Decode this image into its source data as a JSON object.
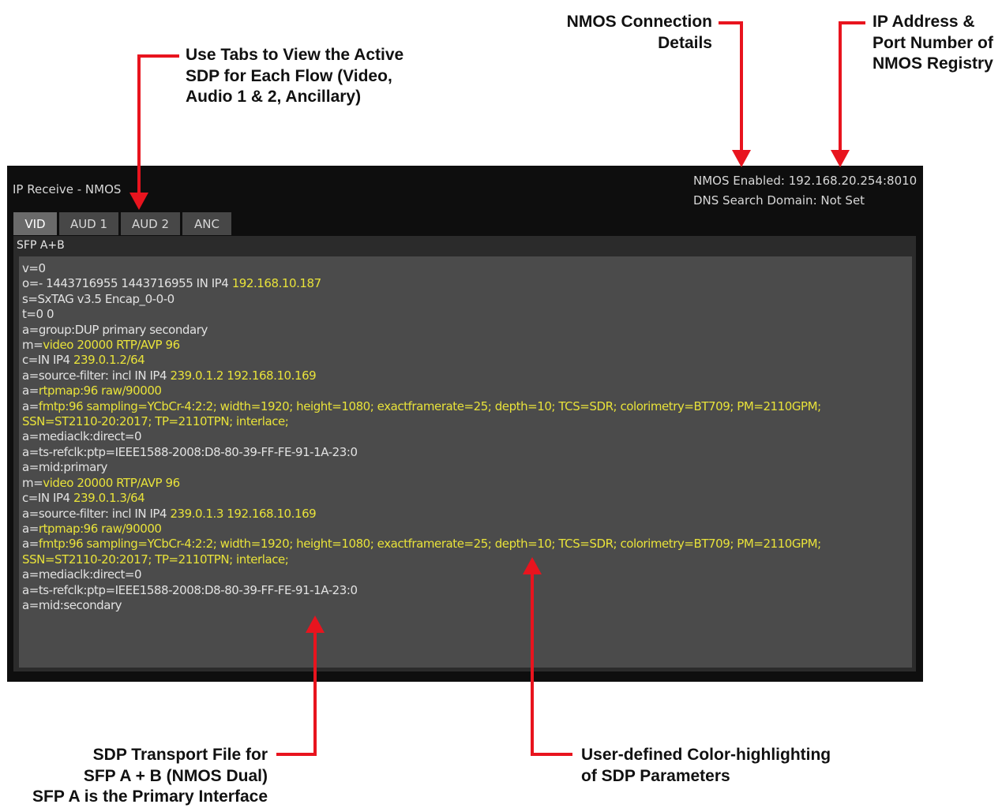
{
  "callouts": {
    "tabs": [
      "Use Tabs to View the Active",
      "SDP for Each Flow (Video,",
      "Audio 1 & 2, Ancillary)"
    ],
    "nmos_connection": [
      "NMOS Connection",
      "Details"
    ],
    "registry": [
      "IP Address &",
      "Port Number of",
      "NMOS Registry"
    ],
    "sdp_file": [
      "SDP Transport File for",
      "SFP A + B (NMOS Dual)",
      "SFP A is the Primary Interface"
    ],
    "color_highlight": [
      "User-defined Color-highlighting",
      "of SDP Parameters"
    ]
  },
  "screen": {
    "title": "IP Receive - NMOS",
    "nmos_enabled": "NMOS Enabled: 192.168.20.254:8010",
    "dns_search_domain": "DNS Search Domain: Not Set",
    "tabs": [
      {
        "label": "VID",
        "active": true
      },
      {
        "label": "AUD 1",
        "active": false
      },
      {
        "label": "AUD 2",
        "active": false
      },
      {
        "label": "ANC",
        "active": false
      }
    ],
    "panel_label": "SFP A+B",
    "sdp_lines": [
      {
        "key": "v=0",
        "value": ""
      },
      {
        "key": "o=- 1443716955 1443716955 IN IP4 ",
        "value": "192.168.10.187"
      },
      {
        "key": "s=SxTAG v3.5 Encap_0-0-0",
        "value": ""
      },
      {
        "key": "t=0 0",
        "value": ""
      },
      {
        "key": "a=group:DUP primary secondary",
        "value": ""
      },
      {
        "key": "m=",
        "value": "video 20000 RTP/AVP 96"
      },
      {
        "key": "c=IN IP4 ",
        "value": "239.0.1.2/64"
      },
      {
        "key": "a=source-filter: incl IN IP4 ",
        "value": "239.0.1.2 192.168.10.169"
      },
      {
        "key": "a=",
        "value": "rtpmap:96 raw/90000"
      },
      {
        "key": "a=",
        "value": "fmtp:96 sampling=YCbCr-4:2:2; width=1920; height=1080; exactframerate=25; depth=10; TCS=SDR; colorimetry=BT709; PM=2110GPM;"
      },
      {
        "key": "",
        "value": "SSN=ST2110-20:2017; TP=2110TPN; interlace;"
      },
      {
        "key": "a=mediaclk:direct=0",
        "value": ""
      },
      {
        "key": "a=ts-refclk:ptp=IEEE1588-2008:D8-80-39-FF-FE-91-1A-23:0",
        "value": ""
      },
      {
        "key": "a=mid:primary",
        "value": ""
      },
      {
        "key": "m=",
        "value": "video 20000 RTP/AVP 96"
      },
      {
        "key": "c=IN IP4 ",
        "value": "239.0.1.3/64"
      },
      {
        "key": "a=source-filter: incl IN IP4 ",
        "value": "239.0.1.3 192.168.10.169"
      },
      {
        "key": "a=",
        "value": "rtpmap:96 raw/90000"
      },
      {
        "key": "a=",
        "value": "fmtp:96 sampling=YCbCr-4:2:2; width=1920; height=1080; exactframerate=25; depth=10; TCS=SDR; colorimetry=BT709; PM=2110GPM;"
      },
      {
        "key": "",
        "value": "SSN=ST2110-20:2017; TP=2110TPN; interlace;"
      },
      {
        "key": "a=mediaclk:direct=0",
        "value": ""
      },
      {
        "key": "a=ts-refclk:ptp=IEEE1588-2008:D8-80-39-FF-FE-91-1A-23:0",
        "value": ""
      },
      {
        "key": "a=mid:secondary",
        "value": ""
      }
    ]
  },
  "colors": {
    "highlight": "#e8e23a",
    "arrow": "#e8141e",
    "screen_background": "#0e0e0e",
    "sdp_background": "#4b4b4b"
  }
}
